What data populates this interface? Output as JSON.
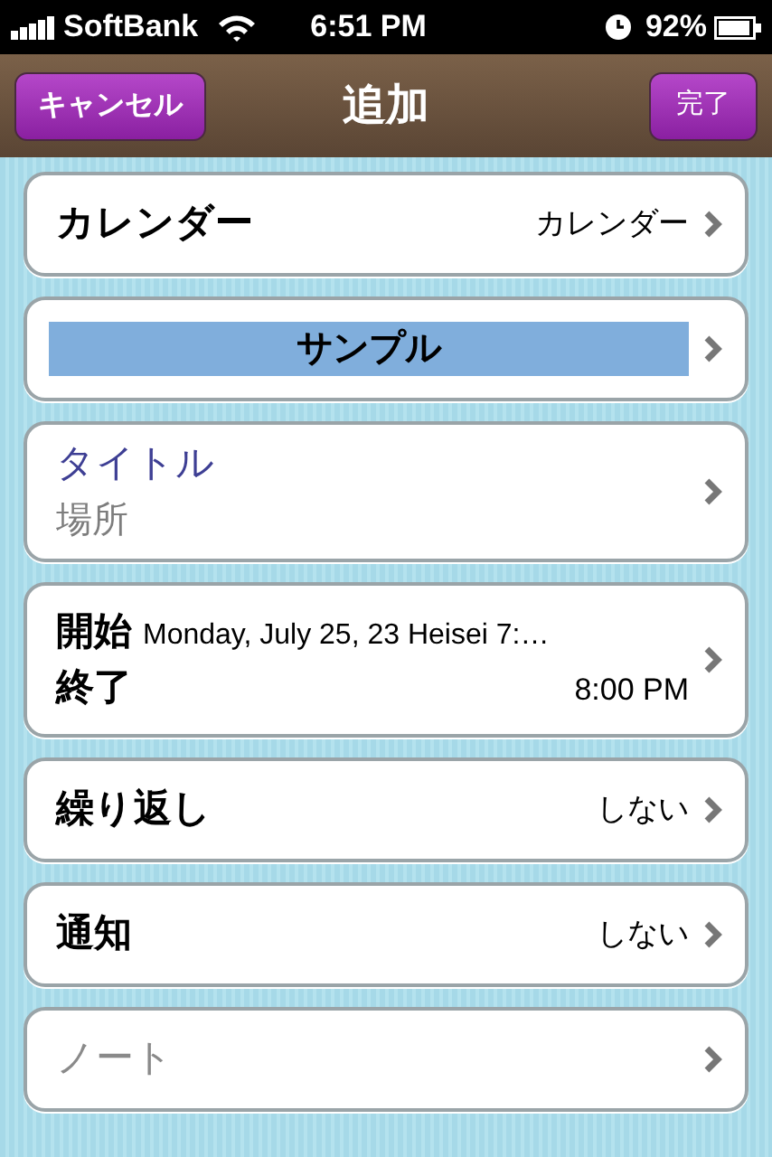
{
  "status_bar": {
    "carrier": "SoftBank",
    "time": "6:51 PM",
    "battery": "92%"
  },
  "nav_bar": {
    "title": "追加",
    "left_button": "キャンセル",
    "right_button": "完了"
  },
  "rows": [
    {
      "kind": "value",
      "label": "カレンダー",
      "value": "カレンダー"
    },
    {
      "kind": "tag",
      "label": "サンプル",
      "color": "#80aedc"
    },
    {
      "kind": "title",
      "placeholder": "タイトル",
      "location_placeholder": "場所"
    },
    {
      "kind": "datetime",
      "start_label": "開始",
      "start": "Monday, July 25, 23 Heisei 7:…",
      "end_label": "終了",
      "end": "8:00 PM"
    },
    {
      "kind": "value",
      "label": "繰り返し",
      "value": "しない"
    },
    {
      "kind": "value",
      "label": "通知",
      "value": "しない"
    },
    {
      "kind": "note",
      "placeholder": "ノート"
    }
  ]
}
